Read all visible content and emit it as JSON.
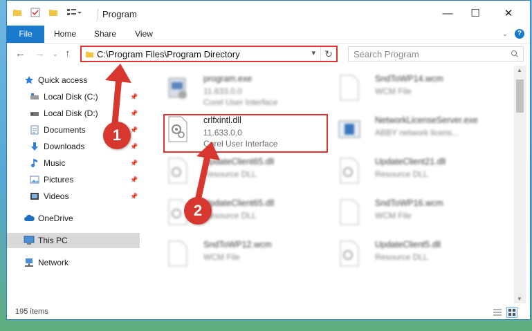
{
  "window": {
    "title": "Program",
    "quick_access_icons": [
      "folder-icon",
      "properties-check-icon",
      "new-folder-icon",
      "customize-toolbar-icon"
    ],
    "controls": {
      "minimize": "—",
      "maximize": "☐",
      "close": "✕"
    }
  },
  "ribbon": {
    "tabs": [
      "File",
      "Home",
      "Share",
      "View"
    ]
  },
  "navigation": {
    "address": "C:\\Program Files\\Program Directory",
    "search_placeholder": "Search Program"
  },
  "sidebar": {
    "quick_access": "Quick access",
    "items": [
      {
        "label": "Local Disk (C:)",
        "icon": "drive-icon",
        "pinned": true
      },
      {
        "label": "Local Disk (D:)",
        "icon": "drive-icon",
        "pinned": true
      },
      {
        "label": "Documents",
        "icon": "documents-icon",
        "pinned": true
      },
      {
        "label": "Downloads",
        "icon": "download-icon",
        "pinned": true
      },
      {
        "label": "Music",
        "icon": "music-icon",
        "pinned": true
      },
      {
        "label": "Pictures",
        "icon": "pictures-icon",
        "pinned": true
      },
      {
        "label": "Videos",
        "icon": "videos-icon",
        "pinned": true
      }
    ],
    "onedrive": "OneDrive",
    "this_pc": "This PC",
    "network": "Network"
  },
  "files": [
    {
      "name": "program.exe",
      "line1": "11.633.0.0",
      "line2": "Corel User Interface",
      "type": "exe"
    },
    {
      "name": "SndToWP14.wcm",
      "line1": "WCM File",
      "line2": "",
      "type": "doc"
    },
    {
      "name": "crlfxintl.dll",
      "line1": "11.633.0.0",
      "line2": "Corel User Interface",
      "type": "dll"
    },
    {
      "name": "NetworkLicenseServer.exe",
      "line1": "ABBY network licens...",
      "line2": "",
      "type": "app"
    },
    {
      "name": "UpdateClient65.dll",
      "line1": "Resource DLL",
      "line2": "",
      "type": "dll"
    },
    {
      "name": "UpdateClient21.dll",
      "line1": "Resource DLL",
      "line2": "",
      "type": "dll"
    },
    {
      "name": "UpdateClient65.dll",
      "line1": "Resource DLL",
      "line2": "",
      "type": "dll"
    },
    {
      "name": "SndToWP16.wcm",
      "line1": "WCM File",
      "line2": "",
      "type": "doc"
    },
    {
      "name": "SndToWP12.wcm",
      "line1": "WCM File",
      "line2": "",
      "type": "doc"
    },
    {
      "name": "UpdateClient5.dll",
      "line1": "Resource DLL",
      "line2": "",
      "type": "dll"
    }
  ],
  "status": {
    "item_count": "195 items"
  },
  "annotations": {
    "step1": "1",
    "step2": "2"
  },
  "colors": {
    "accent": "#1979ca",
    "highlight": "#e0312f",
    "badge": "#d7372f"
  }
}
